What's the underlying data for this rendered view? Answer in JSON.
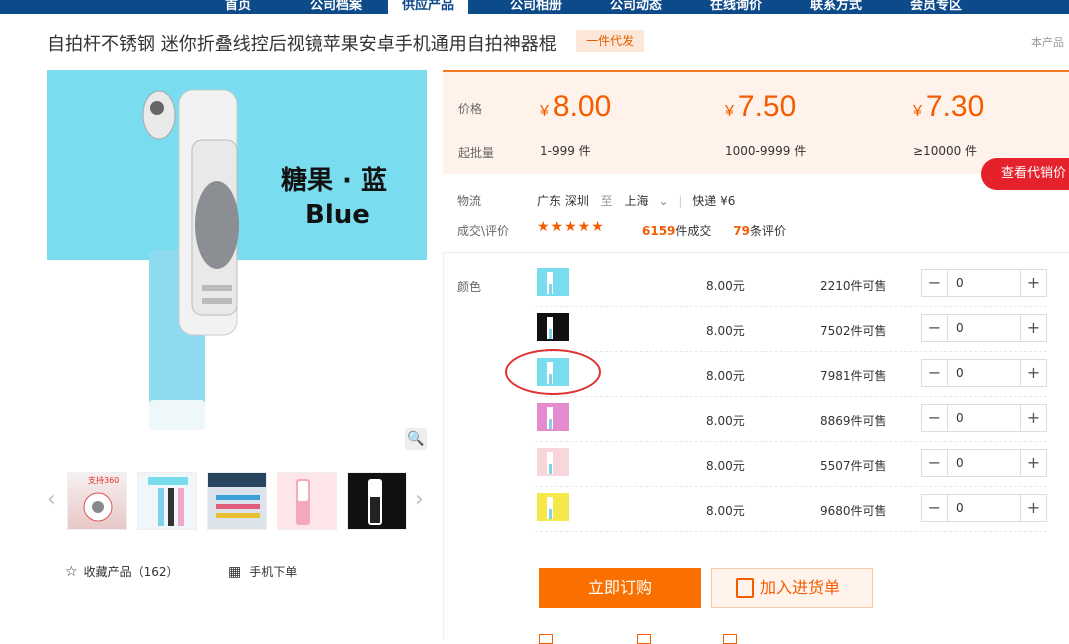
{
  "nav": {
    "items": [
      "首页",
      "公司档案",
      "供应产品",
      "公司相册",
      "公司动态",
      "在线询价",
      "联系方式",
      "会员专区"
    ],
    "active_index": 2
  },
  "product": {
    "title": "自拍杆不锈钢 迷你折叠线控后视镜苹果安卓手机通用自拍神器棍",
    "badge": "一件代发",
    "note": "本产品"
  },
  "gallery": {
    "main_text_cn": "糖果 · 蓝",
    "main_text_en": "Blue",
    "thumbs": [
      "thumb-1",
      "thumb-2",
      "thumb-3",
      "thumb-4",
      "thumb-5"
    ]
  },
  "actions": {
    "fav_label": "收藏产品（162）",
    "mobile_label": "手机下单"
  },
  "pricing": {
    "price_label": "价格",
    "qty_label": "起批量",
    "currency": "¥",
    "tiers": [
      {
        "price": "8.00",
        "range": "1-999 件"
      },
      {
        "price": "7.50",
        "range": "1000-9999 件"
      },
      {
        "price": "7.30",
        "range": "≥10000 件"
      }
    ],
    "agent_btn": "查看代销价"
  },
  "logistics": {
    "label": "物流",
    "from": "广东 深圳",
    "to_word": "至",
    "to": "上海",
    "method": "快递 ¥6"
  },
  "reviews": {
    "label": "成交\\评价",
    "stars": "★★★★★",
    "deals": "6159",
    "deals_suffix": "件成交",
    "count": "79",
    "count_suffix": "条评价"
  },
  "sku": {
    "color_label": "颜色",
    "rows": [
      {
        "price": "8.00元",
        "stock": "2210件可售",
        "qty": "0",
        "color": "#79dcef"
      },
      {
        "price": "8.00元",
        "stock": "7502件可售",
        "qty": "0",
        "color": "#111111"
      },
      {
        "price": "8.00元",
        "stock": "7981件可售",
        "qty": "0",
        "color": "#79dcef"
      },
      {
        "price": "8.00元",
        "stock": "8869件可售",
        "qty": "0",
        "color": "#e58bd0"
      },
      {
        "price": "8.00元",
        "stock": "5507件可售",
        "qty": "0",
        "color": "#f9d6dc"
      },
      {
        "price": "8.00元",
        "stock": "9680件可售",
        "qty": "0",
        "color": "#f5e84a"
      }
    ]
  },
  "buttons": {
    "buy": "立即订购",
    "cart": "加入进货单"
  }
}
